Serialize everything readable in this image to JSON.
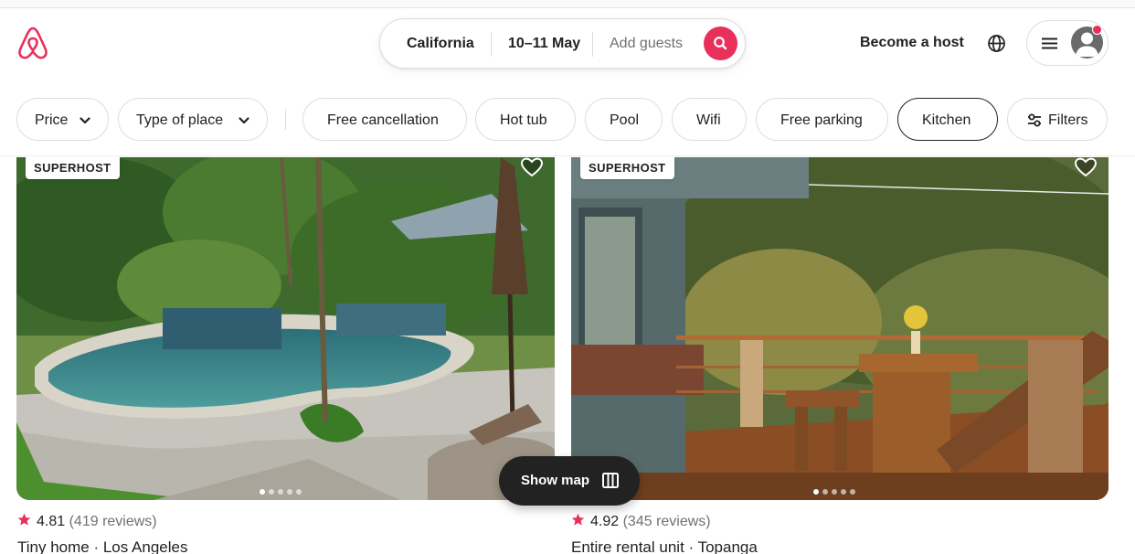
{
  "header": {
    "search": {
      "location": "California",
      "dates": "10–11 May",
      "guests_placeholder": "Add guests"
    },
    "become_host": "Become a host"
  },
  "filters": [
    {
      "label": "Price",
      "dropdown": true
    },
    {
      "label": "Type of place",
      "dropdown": true
    },
    {
      "label": "Free cancellation"
    },
    {
      "label": "Hot tub"
    },
    {
      "label": "Pool"
    },
    {
      "label": "Wifi"
    },
    {
      "label": "Free parking"
    },
    {
      "label": "Kitchen",
      "active": true
    },
    {
      "label": "Filters",
      "icon": "sliders-icon"
    }
  ],
  "listings": [
    {
      "badge": "SUPERHOST",
      "rating": "4.81",
      "reviews": "(419 reviews)",
      "title": "Tiny home · Los Angeles"
    },
    {
      "badge": "SUPERHOST",
      "rating": "4.92",
      "reviews": "(345 reviews)",
      "title": "Entire rental unit · Topanga"
    }
  ],
  "show_map": "Show map",
  "colors": {
    "brand": "#e8305a",
    "text": "#222222",
    "muted": "#717171",
    "border": "#dddddd"
  }
}
